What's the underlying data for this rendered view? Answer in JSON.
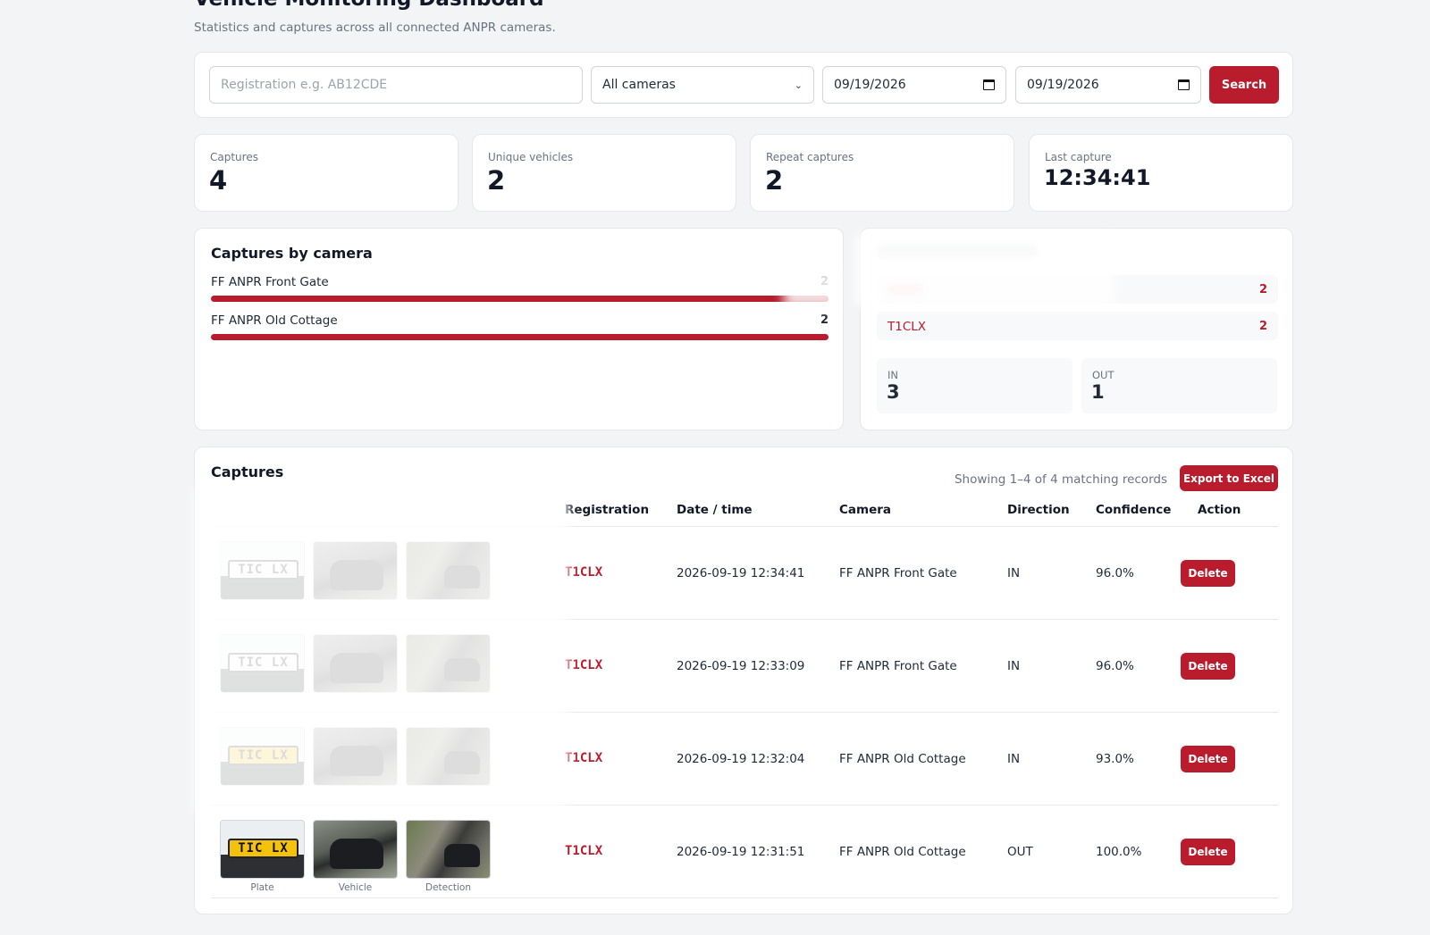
{
  "page": {
    "title": "Vehicle Monitoring Dashboard",
    "subtitle": "Statistics and captures across all connected ANPR cameras."
  },
  "search": {
    "registration_placeholder": "Registration e.g. AB12CDE",
    "camera_selected": "All cameras",
    "date_from": "09/19/2026",
    "date_to": "09/19/2026",
    "button_label": "Search"
  },
  "stats": {
    "captures_label": "Captures",
    "captures_value": "4",
    "unique_label": "Unique vehicles",
    "unique_value": "2",
    "repeat_label": "Repeat captures",
    "repeat_value": "2",
    "last_label": "Last capture",
    "last_value": "12:34:41"
  },
  "camera_panel": {
    "title": "Captures by camera",
    "cameras": [
      {
        "name": "FF ANPR Front Gate",
        "count": "2",
        "share": 1.0
      },
      {
        "name": "FF ANPR Old Cottage",
        "count": "2",
        "share": 1.0
      }
    ]
  },
  "reg_panel": {
    "rows": [
      {
        "reg": "",
        "count": "2"
      },
      {
        "reg": "T1CLX",
        "count": "2"
      }
    ],
    "in_label": "IN",
    "in_value": "3",
    "out_label": "OUT",
    "out_value": "1"
  },
  "captures": {
    "title": "Captures",
    "showing": "Showing 1–4 of 4 matching records",
    "export_label": "Export to Excel",
    "columns": {
      "registration": "Registration",
      "datetime": "Date / time",
      "camera": "Camera",
      "direction": "Direction",
      "confidence": "Confidence",
      "action": "Action"
    },
    "thumb_labels": {
      "plate": "Plate",
      "vehicle": "Vehicle",
      "detection": "Detection"
    },
    "plate_text": "TIC LX",
    "delete_label": "Delete",
    "rows": [
      {
        "reg": "T1CLX",
        "datetime": "2026-09-19 12:34:41",
        "camera": "FF ANPR Front Gate",
        "direction": "IN",
        "confidence": "96.0%"
      },
      {
        "reg": "T1CLX",
        "datetime": "2026-09-19 12:33:09",
        "camera": "FF ANPR Front Gate",
        "direction": "IN",
        "confidence": "96.0%"
      },
      {
        "reg": "T1CLX",
        "datetime": "2026-09-19 12:32:04",
        "camera": "FF ANPR Old Cottage",
        "direction": "IN",
        "confidence": "93.0%"
      },
      {
        "reg": "T1CLX",
        "datetime": "2026-09-19 12:31:51",
        "camera": "FF ANPR Old Cottage",
        "direction": "OUT",
        "confidence": "100.0%"
      }
    ]
  },
  "colors": {
    "accent": "#b91c2c",
    "background": "#f3f4f6"
  }
}
